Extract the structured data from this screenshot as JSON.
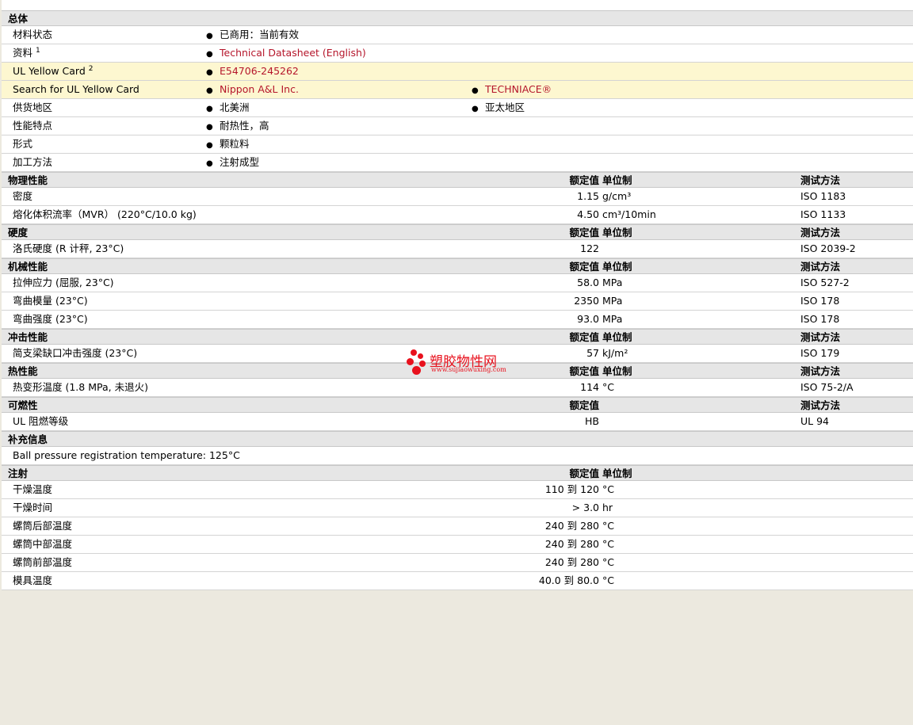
{
  "general": {
    "section": "总体",
    "rows": [
      {
        "label": "材料状态",
        "items": [
          "已商用：当前有效"
        ],
        "links": false
      },
      {
        "label": "资料",
        "sup": "1",
        "items": [
          "Technical Datasheet (English)"
        ],
        "links": true
      },
      {
        "label": "UL Yellow Card",
        "sup": "2",
        "items": [
          "E54706-245262"
        ],
        "links": true,
        "highlight": true
      },
      {
        "label": "Search for UL Yellow Card",
        "items": [
          "Nippon A&L Inc.",
          "TECHNIACE®"
        ],
        "links": true,
        "highlight": true
      },
      {
        "label": "供货地区",
        "items": [
          "北美洲",
          "亚太地区"
        ],
        "links": false
      },
      {
        "label": "性能特点",
        "items": [
          "耐热性，高"
        ],
        "links": false
      },
      {
        "label": "形式",
        "items": [
          "颗粒料"
        ],
        "links": false
      },
      {
        "label": "加工方法",
        "items": [
          "注射成型"
        ],
        "links": false
      }
    ]
  },
  "columns": {
    "value": "额定值",
    "unit": "单位制",
    "method": "测试方法"
  },
  "sections": [
    {
      "title": "物理性能",
      "show_unit": true,
      "show_method": true,
      "rows": [
        {
          "label": "密度",
          "value": "1.15",
          "unit": "g/cm³",
          "method": "ISO 1183"
        },
        {
          "label": "熔化体积流率（MVR） (220°C/10.0 kg)",
          "value": "4.50",
          "unit": "cm³/10min",
          "method": "ISO 1133"
        }
      ]
    },
    {
      "title": "硬度",
      "show_unit": true,
      "show_method": true,
      "rows": [
        {
          "label": "洛氏硬度 (R 计秤, 23°C)",
          "value": "122",
          "unit": "",
          "method": "ISO 2039-2"
        }
      ]
    },
    {
      "title": "机械性能",
      "show_unit": true,
      "show_method": true,
      "rows": [
        {
          "label": "拉伸应力 (屈服, 23°C)",
          "value": "58.0",
          "unit": "MPa",
          "method": "ISO 527-2"
        },
        {
          "label": "弯曲模量 (23°C)",
          "value": "2350",
          "unit": "MPa",
          "method": "ISO 178"
        },
        {
          "label": "弯曲强度 (23°C)",
          "value": "93.0",
          "unit": "MPa",
          "method": "ISO 178"
        }
      ]
    },
    {
      "title": "冲击性能",
      "show_unit": true,
      "show_method": true,
      "rows": [
        {
          "label": "简支梁缺口冲击强度 (23°C)",
          "value": "57",
          "unit": "kJ/m²",
          "method": "ISO 179"
        }
      ]
    },
    {
      "title": "热性能",
      "show_unit": true,
      "show_method": true,
      "rows": [
        {
          "label": "热变形温度 (1.8 MPa, 未退火)",
          "value": "114",
          "unit": "°C",
          "method": "ISO 75-2/A"
        }
      ]
    },
    {
      "title": "可燃性",
      "show_unit": false,
      "show_method": true,
      "rows": [
        {
          "label": "UL 阻燃等级",
          "value": "HB",
          "unit": "",
          "method": "UL 94"
        }
      ]
    }
  ],
  "supplement": {
    "title": "补充信息",
    "text": "Ball pressure registration temperature: 125°C"
  },
  "injection": {
    "title": "注射",
    "rows": [
      {
        "label": "干燥温度",
        "value": "110 到  120",
        "unit": "°C"
      },
      {
        "label": "干燥时间",
        "value": "> 3.0",
        "unit": "hr"
      },
      {
        "label": "螺筒后部温度",
        "value": "240 到  280",
        "unit": "°C"
      },
      {
        "label": "螺筒中部温度",
        "value": "240 到  280",
        "unit": "°C"
      },
      {
        "label": "螺筒前部温度",
        "value": "240 到  280",
        "unit": "°C"
      },
      {
        "label": "模具温度",
        "value": "40.0 到  80.0",
        "unit": "°C"
      }
    ]
  },
  "watermark": {
    "cn": "塑胶物性网",
    "en": "www.sujiaowuxing.com",
    "color": "#e8111d"
  },
  "link_color": "#b5162b"
}
